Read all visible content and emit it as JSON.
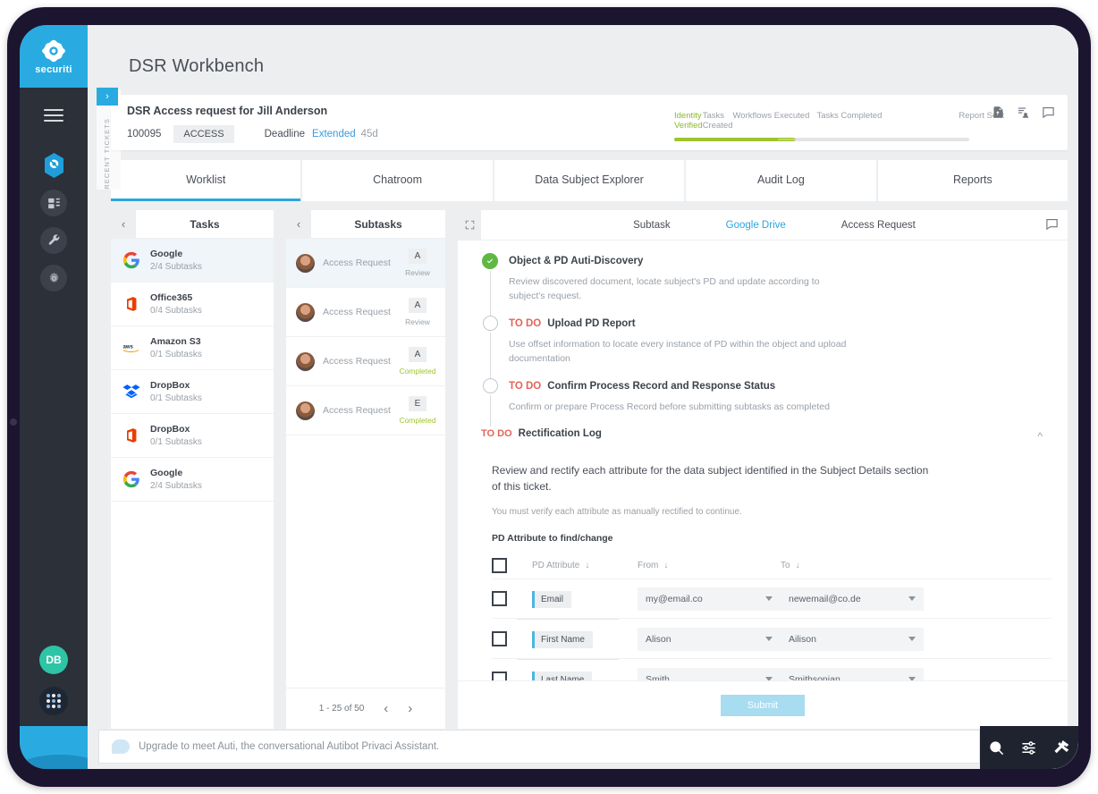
{
  "app": {
    "brand": "securiti",
    "page_title": "DSR Workbench"
  },
  "sidebar": {
    "icons": [
      {
        "name": "menu-icon",
        "label": "Menu"
      },
      {
        "name": "hexagon-privaci-icon",
        "label": "Privaci"
      },
      {
        "name": "dashboard-icon",
        "label": "Dashboard"
      },
      {
        "name": "wrench-icon",
        "label": "Tools"
      },
      {
        "name": "gear-icon",
        "label": "Settings"
      }
    ],
    "avatar_initials": "DB",
    "apps_grid_label": "Apps"
  },
  "recent_tickets": {
    "label": "RECENT TICKETS",
    "expand_arrow": "›"
  },
  "ticket": {
    "title": "DSR Access request for Jill Anderson",
    "id": "100095",
    "type": "ACCESS",
    "deadline_label": "Deadline",
    "deadline_status": "Extended",
    "deadline_days": "45d",
    "header_icons": [
      "document-upload-icon",
      "assign-user-icon",
      "comment-icon"
    ],
    "progress": {
      "steps": [
        "Identity Verified",
        "Tasks Created",
        "Workflows Executed",
        "Tasks Completed",
        "Report Sent"
      ],
      "completed_index": 1,
      "fill_percent": 41,
      "fill_color": "#9ec42e"
    }
  },
  "tabs": [
    {
      "label": "Worklist",
      "active": true
    },
    {
      "label": "Chatroom",
      "active": false
    },
    {
      "label": "Data Subject Explorer",
      "active": false
    },
    {
      "label": "Audit Log",
      "active": false
    },
    {
      "label": "Reports",
      "active": false
    }
  ],
  "tasks_panel": {
    "title": "Tasks",
    "back_icon": "chevron-left-icon",
    "items": [
      {
        "name": "Google",
        "subtasks": "2/4 Subtasks",
        "icon": "google-icon",
        "selected": true
      },
      {
        "name": "Office365",
        "subtasks": "0/4 Subtasks",
        "icon": "office365-icon",
        "selected": false
      },
      {
        "name": "Amazon S3",
        "subtasks": "0/1 Subtasks",
        "icon": "aws-icon",
        "selected": false
      },
      {
        "name": "DropBox",
        "subtasks": "0/1 Subtasks",
        "icon": "dropbox-icon",
        "selected": false
      },
      {
        "name": "DropBox",
        "subtasks": "0/1 Subtasks",
        "icon": "office365-icon",
        "selected": false
      },
      {
        "name": "Google",
        "subtasks": "2/4 Subtasks",
        "icon": "google-icon",
        "selected": false
      }
    ]
  },
  "subtasks_panel": {
    "title": "Subtasks",
    "back_icon": "chevron-left-icon",
    "items": [
      {
        "name": "Access Request",
        "badge": "A",
        "status": "Review",
        "done": false,
        "selected": true
      },
      {
        "name": "Access Request",
        "badge": "A",
        "status": "Review",
        "done": false,
        "selected": false
      },
      {
        "name": "Access Request",
        "badge": "A",
        "status": "Completed",
        "done": true,
        "selected": false
      },
      {
        "name": "Access Request",
        "badge": "E",
        "status": "Completed",
        "done": true,
        "selected": false
      }
    ],
    "pagination": {
      "range": "1 - 25 of 50",
      "prev": "‹",
      "next": "›"
    }
  },
  "detail_panel": {
    "expand_icon": "expand-icon",
    "comment_icon": "comment-icon",
    "breadcrumbs": {
      "c1": "Subtask",
      "c2": "Google Drive",
      "c3": "Access Request"
    },
    "steps": [
      {
        "state": "done",
        "todo_label": "",
        "title": "Object & PD Auti-Discovery",
        "description": "Review discovered document, locate subject's PD and update according to subject's request."
      },
      {
        "state": "open",
        "todo_label": "TO DO",
        "title": "Upload PD Report",
        "description": "Use offset information to locate every instance of PD within the object and upload documentation"
      },
      {
        "state": "open",
        "todo_label": "TO DO",
        "title": "Confirm Process Record and Response Status",
        "description": "Confirm or prepare Process Record before submitting subtasks as completed"
      }
    ],
    "rectification": {
      "todo_label": "TO DO",
      "title": "Rectification Log",
      "collapse_icon": "chevron-up-icon",
      "intro": "Review and rectify each attribute for the data subject identified in the Subject Details section of this ticket.",
      "note": "You must verify each attribute as manually rectified to continue.",
      "sublabel": "PD Attribute to find/change",
      "columns": [
        "PD Attribute",
        "From",
        "To"
      ],
      "sort_icon": "↓",
      "rows": [
        {
          "attribute": "Email",
          "from": "my@email.co",
          "to": "newemail@co.de"
        },
        {
          "attribute": "First Name",
          "from": "Alison",
          "to": "Ailison"
        },
        {
          "attribute": "Last Name",
          "from": "Smith",
          "to": "Smithsonian"
        }
      ]
    },
    "submit_label": "Submit"
  },
  "bottom_bar": {
    "message": "Upgrade to meet Auti, the conversational Autibot Privaci Assistant.",
    "icons": [
      "search-icon",
      "filters-icon",
      "hammer-icon"
    ]
  },
  "colors": {
    "brand_blue": "#29abe2",
    "accent_blue": "#2ba6dd",
    "progress_green": "#9ec42e",
    "todo_red": "#e4645a",
    "done_green": "#5fb842",
    "avatar_teal": "#2ec4a6"
  }
}
